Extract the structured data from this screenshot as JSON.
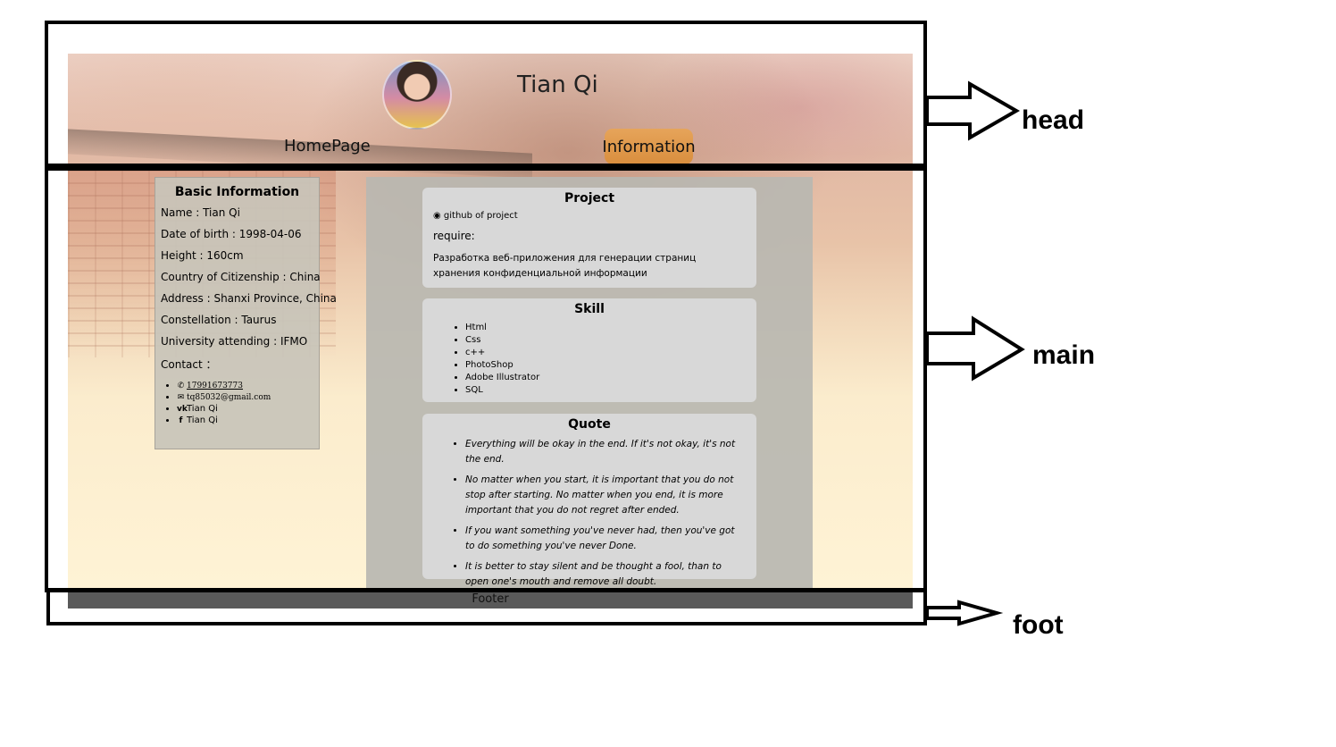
{
  "site": {
    "title": "Tian Qi",
    "nav": {
      "home": "HomePage",
      "info": "Information"
    },
    "basic": {
      "heading": "Basic Information",
      "rows": [
        "Name : Tian Qi",
        "Date of birth : 1998-04-06",
        "Height : 160cm",
        "Country of Citizenship : China",
        "Address : Shanxi Province, China",
        "Constellation : Taurus",
        "University attending : IFMO",
        "Contact ："
      ],
      "contacts": [
        {
          "icon": "phone-icon",
          "glyph": "✆",
          "text": "17991673773"
        },
        {
          "icon": "mail-icon",
          "glyph": "✉",
          "text": "tq85032@gmail.com"
        },
        {
          "icon": "vk-icon",
          "glyph": "vk",
          "text": "Tian Qi"
        },
        {
          "icon": "facebook-icon",
          "glyph": "f",
          "text": "Tian Qi"
        }
      ]
    },
    "project": {
      "heading": "Project",
      "github_text": "github of project",
      "require_label": "require:",
      "description": "Разработка веб-приложения для генерации страниц хранения конфиденциальной информации"
    },
    "skill": {
      "heading": "Skill",
      "items": [
        "Html",
        "Css",
        "c++",
        "PhotoShop",
        "Adobe Illustrator",
        "SQL"
      ]
    },
    "quote": {
      "heading": "Quote",
      "items": [
        "Everything will be okay in the end. If it's not okay, it's not the end.",
        "No matter when you start, it is important that you do not stop after starting. No matter when you end, it is more important that you do not regret after ended.",
        "If you want something you've never had, then you've got to do something you've never Done.",
        "It is better to stay silent and be thought a fool, than to open one's mouth and remove all doubt."
      ]
    },
    "footer": "Footer"
  },
  "annotations": {
    "head": "head",
    "main": "main",
    "foot": "foot"
  },
  "colors": {
    "nav_active": "#e09a4c",
    "card": "#d8d8d8",
    "footer": "#595959"
  }
}
